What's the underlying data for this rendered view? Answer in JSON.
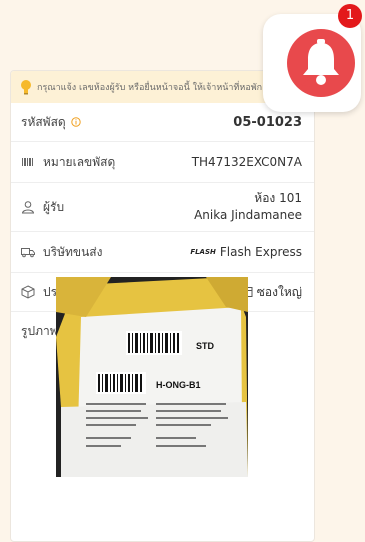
{
  "notice": {
    "text": "กรุณาแจ้ง เลขห้องผู้รับ หรือยื่นหน้าจอนี้ ให้เจ้าหน้าที่หอพัก เพื่อรับพัสดุ"
  },
  "parcel": {
    "code_label": "รหัสพัสดุ",
    "code_value": "05-01023",
    "tracking_label": "หมายเลขพัสดุ",
    "tracking_value": "TH47132EXC0N7A",
    "recipient_label": "ผู้รับ",
    "recipient_room": "ห้อง 101",
    "recipient_name": "Anika Jindamanee",
    "carrier_label": "บริษัทขนส่ง",
    "carrier_logo": "FLASH",
    "carrier_value": "Flash Express",
    "type_label": "ประเภทพัสดุ",
    "type_value": "ซองใหญ่",
    "photo_label": "รูปภาพพัสดุ"
  },
  "photo_text": {
    "std": "STD",
    "sort": "H-ONG-B1"
  },
  "notification": {
    "count": "1"
  },
  "colors": {
    "accent": "#e8494c",
    "notice_bg": "#fdf1d6",
    "info": "#f0a020"
  }
}
